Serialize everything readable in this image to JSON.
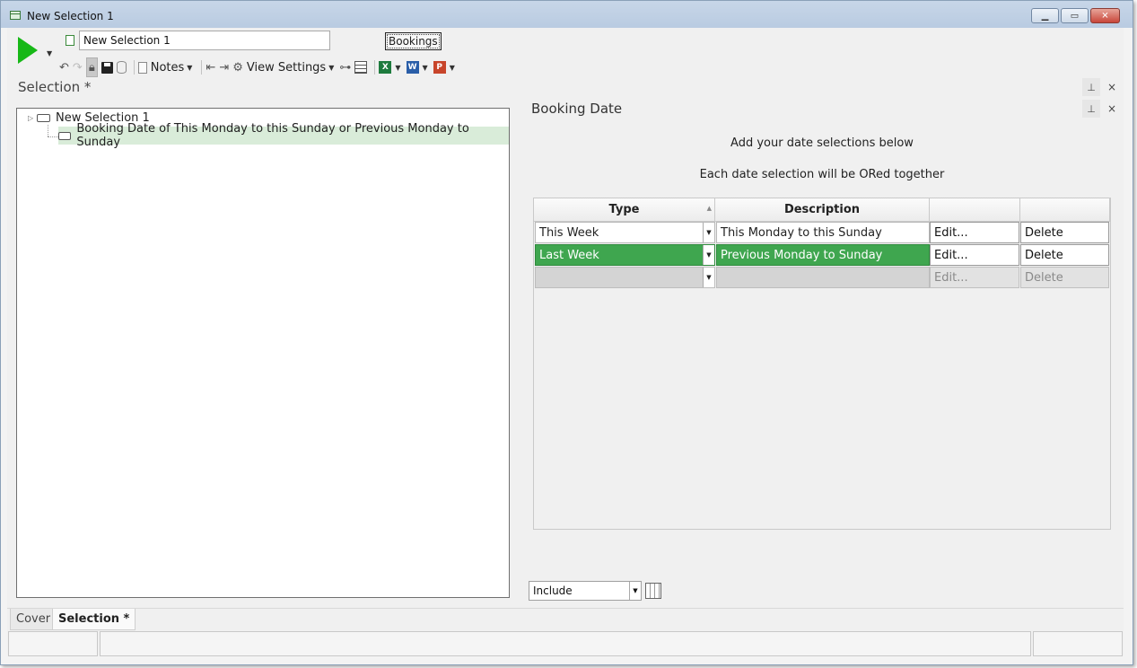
{
  "window": {
    "title": "New Selection 1"
  },
  "toolbar": {
    "name_value": "New Selection 1",
    "bookings_label": "Bookings",
    "notes_label": "Notes",
    "view_settings_label": "View Settings",
    "icons": [
      "play-icon",
      "undo-icon",
      "redo-icon",
      "lock-icon",
      "save-icon",
      "database-icon",
      "clipboard-icon",
      "outdent-icon",
      "indent-icon",
      "settings-icon",
      "hierarchy-icon",
      "grid-icon",
      "excel-icon",
      "word-icon",
      "powerpoint-icon"
    ]
  },
  "left_pane": {
    "label": "Selection *",
    "tree": [
      {
        "label": "New Selection 1"
      },
      {
        "label": "Booking Date of This Monday to this Sunday or Previous Monday to Sunday"
      }
    ]
  },
  "right_pane": {
    "title": "Booking Date",
    "instructions": [
      "Add your date selections below",
      "Each date selection will be ORed together"
    ],
    "columns": [
      "Type",
      "Description",
      "",
      ""
    ],
    "rows": [
      {
        "type": "This Week",
        "description": "This Monday to this Sunday",
        "edit": "Edit...",
        "delete": "Delete",
        "selected": false
      },
      {
        "type": "Last Week",
        "description": "Previous Monday to Sunday",
        "edit": "Edit...",
        "delete": "Delete",
        "selected": true
      },
      {
        "type": "",
        "description": "",
        "edit": "Edit...",
        "delete": "Delete",
        "selected": false
      }
    ],
    "include_value": "Include"
  },
  "tabs": [
    "Cover",
    "Selection *"
  ],
  "colors": {
    "accent_green": "#3fa64f",
    "play_green": "#17b817",
    "tree_highlight": "#d9ecd9"
  }
}
